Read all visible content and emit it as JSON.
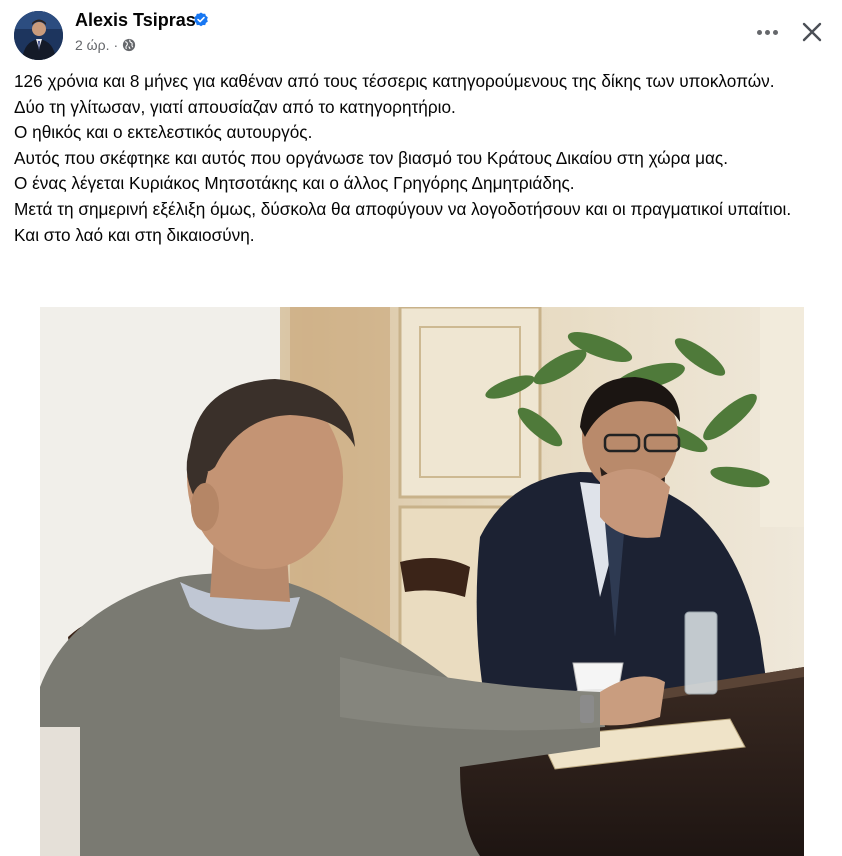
{
  "author": {
    "name": "Alexis Tsipras",
    "verified_icon": "verified-badge-icon",
    "time": "2 ώρ.",
    "separator": "·",
    "audience_icon": "globe-icon"
  },
  "actions": {
    "more_icon": "more-options-icon",
    "close_icon": "close-icon"
  },
  "post": {
    "lines": [
      "126 χρόνια και 8 μήνες για καθέναν από τους τέσσερις κατηγορούμενους της δίκης των υποκλοπών.",
      "Δύο τη γλίτωσαν, γιατί απουσίαζαν από το κατηγορητήριο.",
      "Ο ηθικός και ο εκτελεστικός αυτουργός.",
      "Αυτός που σκέφτηκε και αυτός που οργάνωσε τον βιασμό του Κράτους Δικαίου στη χώρα μας.",
      "Ο ένας λέγεται Κυριάκος Μητσοτάκης και ο άλλος Γρηγόρης Δημητριάδης.",
      "Μετά τη σημερινή εξέλιξη όμως, δύσκολα θα αποφύγουν να λογοδοτήσουν και οι πραγματικοί υπαίτιοι.",
      "Και στο λαό και στη δικαιοσύνη."
    ]
  },
  "colors": {
    "verified_blue": "#1877f2",
    "secondary_text": "#65676b",
    "primary_text": "#050505"
  }
}
